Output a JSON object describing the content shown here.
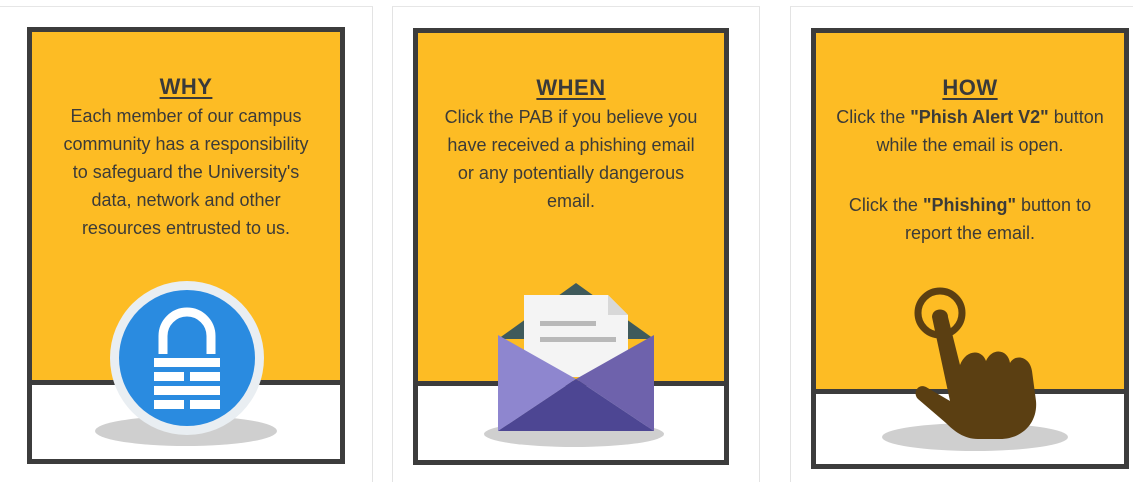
{
  "cards": [
    {
      "title": "WHY",
      "text": "Each member of our campus community has a responsibility to safeguard the University's data, network and other resources entrusted to us.",
      "icon": "lock-icon"
    },
    {
      "title": "WHEN",
      "text": "Click the PAB if you believe you have received a phishing email or any potentially dangerous email.",
      "icon": "envelope-icon"
    },
    {
      "title": "HOW",
      "line1_pre": "Click the ",
      "line1_bold": "\"Phish Alert V2\"",
      "line1_post": " button while the email is open.",
      "line2_pre": "Click the ",
      "line2_bold": "\"Phishing\"",
      "line2_post": " button to report the email.",
      "icon": "pointing-hand-icon"
    }
  ],
  "colors": {
    "card_yellow": "#fdbc24",
    "border": "#3c3c3c",
    "lock_blue": "#2a8be0",
    "envelope_purple": "#6e62ac",
    "hand_brown": "#5b3f12"
  }
}
